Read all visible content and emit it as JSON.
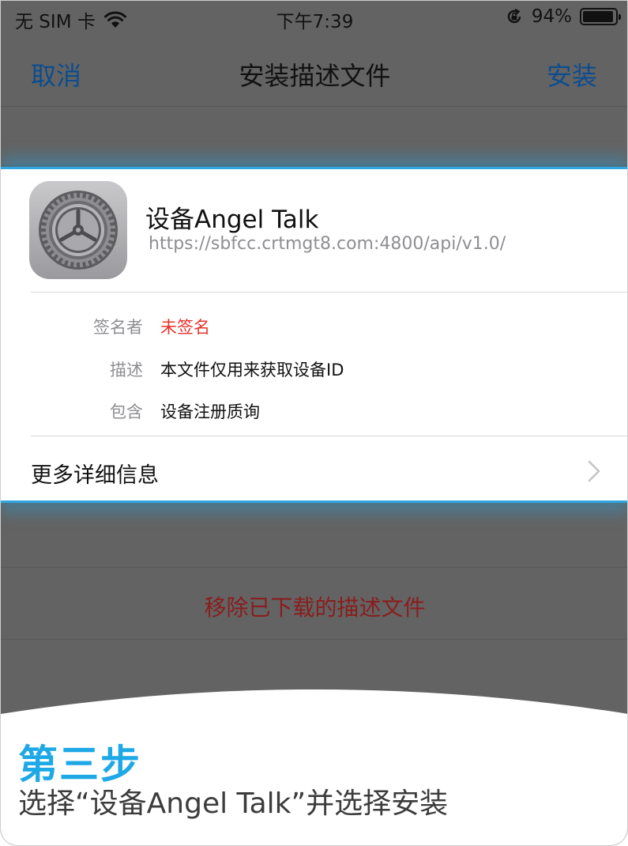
{
  "status_bar": {
    "carrier": "无 SIM 卡",
    "time": "下午7:39",
    "battery": "94%",
    "battery_level": 0.94
  },
  "nav": {
    "cancel": "取消",
    "title": "安装描述文件",
    "install": "安装"
  },
  "profile": {
    "name": "设备Angel Talk",
    "url": "https://sbfcc.crtmgt8.com:4800/api/v1.0/",
    "icon": "settings-gear-icon",
    "details": [
      {
        "label": "签名者",
        "value": "未签名"
      },
      {
        "label": "描述",
        "value": "本文件仅用来获取设备ID"
      },
      {
        "label": "包含",
        "value": "设备注册质询"
      }
    ],
    "more_info": "更多详细信息"
  },
  "remove_button": "移除已下载的描述文件",
  "instruction": {
    "step": "第三步",
    "text": "选择“设备Angel Talk”并选择安装"
  },
  "colors": {
    "accent_blue": "#1ea9e6",
    "link_blue": "#0d4c8f",
    "unsigned_red": "#e8332a",
    "highlight_border": "#2ea6df"
  }
}
